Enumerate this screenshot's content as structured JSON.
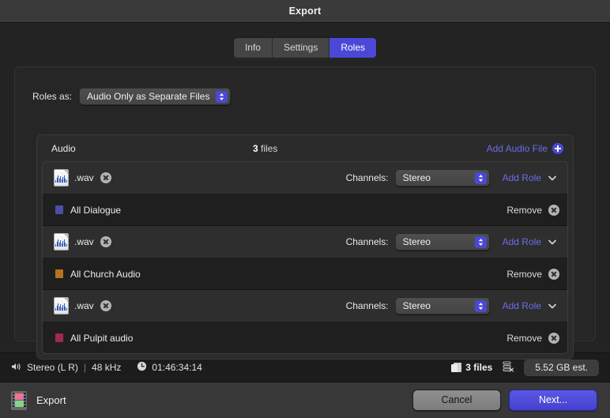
{
  "window": {
    "title": "Export"
  },
  "tabs": [
    {
      "label": "Info",
      "active": false
    },
    {
      "label": "Settings",
      "active": false
    },
    {
      "label": "Roles",
      "active": true
    }
  ],
  "roles_as": {
    "label": "Roles as:",
    "value": "Audio Only as Separate Files"
  },
  "audio_section": {
    "title": "Audio",
    "file_count_number": "3",
    "file_count_suffix": " files",
    "add_audio_label": "Add Audio File",
    "add_icon": "plus-circle-icon"
  },
  "files": [
    {
      "icon": "wav-file-icon",
      "name": ".wav",
      "remove_icon": "close-circle-icon",
      "channels_label": "Channels:",
      "channels_value": "Stereo",
      "add_role_label": "Add Role",
      "chevron_icon": "chevron-down-icon",
      "role": {
        "name": "All Dialogue",
        "color": "#4a4fa8",
        "remove_label": "Remove",
        "remove_icon": "close-circle-icon"
      }
    },
    {
      "icon": "wav-file-icon",
      "name": ".wav",
      "remove_icon": "close-circle-icon",
      "channels_label": "Channels:",
      "channels_value": "Stereo",
      "add_role_label": "Add Role",
      "chevron_icon": "chevron-down-icon",
      "role": {
        "name": "All Church Audio",
        "color": "#b5751f",
        "remove_label": "Remove",
        "remove_icon": "close-circle-icon"
      }
    },
    {
      "icon": "wav-file-icon",
      "name": ".wav",
      "remove_icon": "close-circle-icon",
      "channels_label": "Channels:",
      "channels_value": "Stereo",
      "add_role_label": "Add Role",
      "chevron_icon": "chevron-down-icon",
      "role": {
        "name": "All Pulpit audio",
        "color": "#9e2a50",
        "remove_label": "Remove",
        "remove_icon": "close-circle-icon"
      }
    }
  ],
  "status_bar": {
    "speaker_icon": "speaker-icon",
    "audio_format": "Stereo (L R)",
    "separator": "|",
    "sample_rate": "48 kHz",
    "clock_icon": "clock-icon",
    "duration": "01:46:34:14",
    "files_icon": "documents-icon",
    "files_count": "3 files",
    "layers_icon": "layers-remove-icon",
    "size_estimate": "5.52 GB est."
  },
  "footer": {
    "icon": "filmstrip-icon",
    "title": "Export",
    "cancel_label": "Cancel",
    "next_label": "Next..."
  },
  "colors": {
    "accent": "#4b48d6",
    "link": "#6e6bea",
    "window_bg": "#222222",
    "titlebar_bg": "#3a3a3a"
  }
}
